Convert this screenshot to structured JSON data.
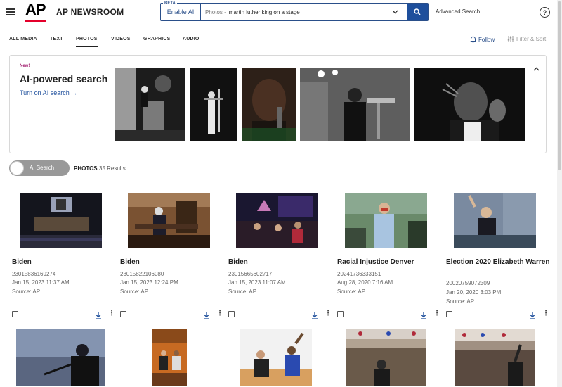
{
  "header": {
    "brand": "AP NEWSROOM",
    "logo_text": "AP",
    "beta_label": "BETA",
    "enable_ai_label": "Enable AI",
    "search_scope": "Photos -",
    "search_value": "martin luther king on a stage",
    "advanced_search_label": "Advanced Search",
    "help_label": "?"
  },
  "tabs": [
    {
      "label": "ALL MEDIA"
    },
    {
      "label": "TEXT"
    },
    {
      "label": "PHOTOS"
    },
    {
      "label": "VIDEOS"
    },
    {
      "label": "GRAPHICS"
    },
    {
      "label": "AUDIO"
    }
  ],
  "actions": {
    "follow_label": "Follow",
    "filter_label": "Filter & Sort"
  },
  "banner": {
    "new_label": "New!",
    "title": "AI-powered search",
    "turn_on_label": "Turn on AI search"
  },
  "results_bar": {
    "toggle_label": "AI Search",
    "section_label": "PHOTOS",
    "count_label": "35 Results"
  },
  "cards": [
    {
      "title": "Biden",
      "id": "23015836169274",
      "date": "Jan 15, 2023 11:37 AM",
      "source": "Source: AP"
    },
    {
      "title": "Biden",
      "id": "23015822106080",
      "date": "Jan 15, 2023 12:24 PM",
      "source": "Source: AP"
    },
    {
      "title": "Biden",
      "id": "23015665602717",
      "date": "Jan 15, 2023 11:07 AM",
      "source": "Source: AP"
    },
    {
      "title": "Racial Injustice Denver",
      "id": "20241736333151",
      "date": "Aug 28, 2020 7:16 AM",
      "source": "Source: AP"
    },
    {
      "title": "Election 2020 Elizabeth Warren",
      "id": "20020759072309",
      "date": "Jan 20, 2020 3:03 PM",
      "source": "Source: AP"
    }
  ],
  "colors": {
    "accent": "#1e4f9c",
    "ap_red": "#e4002b",
    "new_badge": "#a0186b"
  }
}
